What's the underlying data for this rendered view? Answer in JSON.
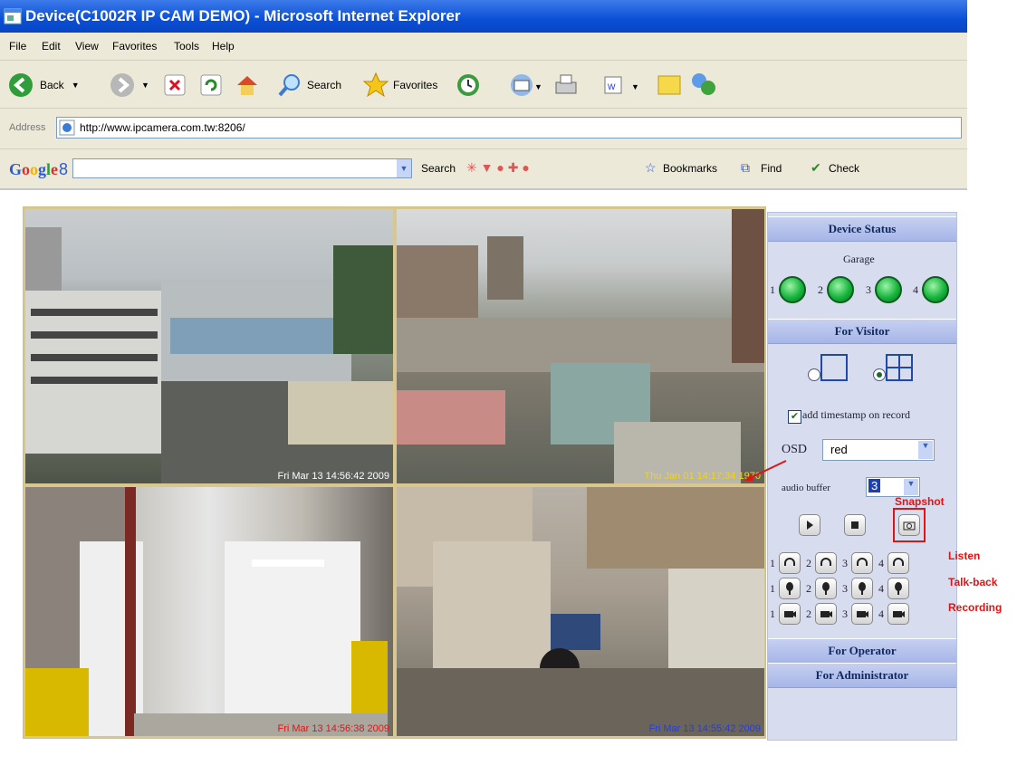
{
  "window": {
    "title": "Device(C1002R IP CAM DEMO) - Microsoft Internet Explorer"
  },
  "menu": [
    "File",
    "Edit",
    "View",
    "Favorites",
    "Tools",
    "Help"
  ],
  "toolbar": {
    "back": "Back",
    "search": "Search",
    "favorites": "Favorites"
  },
  "address": {
    "label": "Address",
    "url": "http://www.ipcamera.com.tw:8206/"
  },
  "google_bar": {
    "logo": "Google",
    "search": "Search",
    "bookmarks": "Bookmarks",
    "find": "Find",
    "check": "Check"
  },
  "cameras": [
    {
      "timestamp": "Fri Mar 13 14:56:42 2009",
      "ts_color": "#ffffff"
    },
    {
      "timestamp": "Thu Jan 01 14:17:34 1970",
      "ts_color": "#f2d21a"
    },
    {
      "timestamp": "Fri Mar 13 14:56:38 2009",
      "ts_color": "#e01414"
    },
    {
      "timestamp": "Fri Mar 13 14:55:42 2009",
      "ts_color": "#2440d8"
    }
  ],
  "panel": {
    "device_status": "Device Status",
    "garage": "Garage",
    "channels": [
      "1",
      "2",
      "3",
      "4"
    ],
    "for_visitor": "For Visitor",
    "add_timestamp": "add timestamp on record",
    "osd_label": "OSD",
    "osd_value": "red",
    "audio_buffer_label": "audio buffer",
    "audio_buffer_value": "3",
    "for_operator": "For Operator",
    "for_administrator": "For Administrator"
  },
  "annotations": {
    "snapshot": "Snapshot",
    "listen": "Listen",
    "talkback": "Talk-back",
    "recording": "Recording"
  }
}
